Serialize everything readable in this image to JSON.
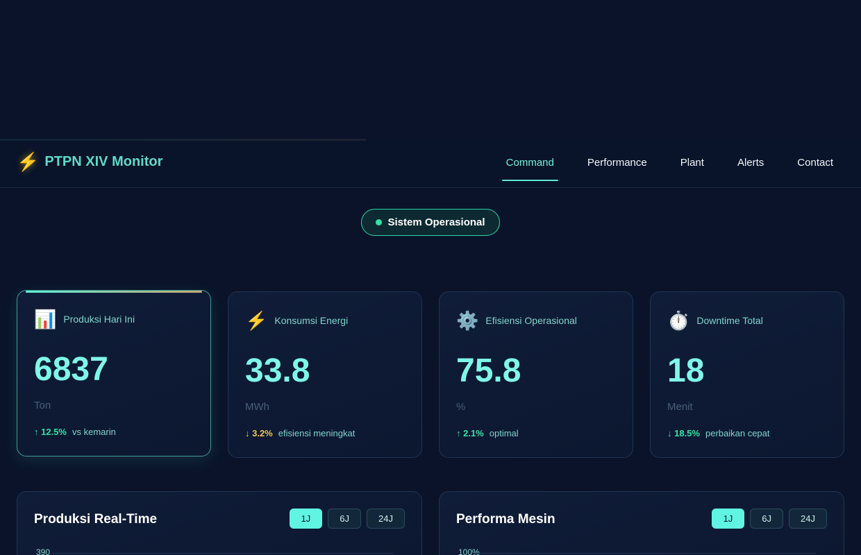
{
  "progress": {
    "fraction": 0.425
  },
  "nav": {
    "brand": "PTPN XIV Monitor",
    "brand_icon": "lightning-icon",
    "links": [
      "Command",
      "Performance",
      "Plant",
      "Alerts",
      "Contact"
    ],
    "active": "Command"
  },
  "status": {
    "label": "Sistem Operasional",
    "color": "#34e3a8"
  },
  "cards": [
    {
      "icon": "📊",
      "icon_name": "bar-chart-icon",
      "label": "Produksi Hari Ini",
      "value": "6837",
      "unit": "Ton",
      "trend": "↑ 12.5%",
      "trend_dir": "up",
      "note": "vs kemarin"
    },
    {
      "icon": "⚡",
      "icon_name": "lightning-icon",
      "label": "Konsumsi Energi",
      "value": "33.8",
      "unit": "MWh",
      "trend": "↓ 3.2%",
      "trend_dir": "down",
      "note": "efisiensi meningkat"
    },
    {
      "icon": "⚙️",
      "icon_name": "gear-icon",
      "label": "Efisiensi Operasional",
      "value": "75.8",
      "unit": "%",
      "trend": "↑ 2.1%",
      "trend_dir": "up",
      "note": "optimal"
    },
    {
      "icon": "⏱️",
      "icon_name": "stopwatch-icon",
      "label": "Downtime Total",
      "value": "18",
      "unit": "Menit",
      "trend": "↓ 18.5%",
      "trend_dir": "down-good",
      "note": "perbaikan cepat"
    }
  ],
  "panels": [
    {
      "title": "Produksi Real-Time",
      "ranges": [
        "1J",
        "6J",
        "24J"
      ],
      "active_range": "1J",
      "y_top_label": "390"
    },
    {
      "title": "Performa Mesin",
      "ranges": [
        "1J",
        "6J",
        "24J"
      ],
      "active_range": "1J",
      "y_top_label": "100%"
    }
  ],
  "colors": {
    "accent": "#5eead4",
    "background": "#0a1329",
    "warning": "#f2c34b"
  }
}
